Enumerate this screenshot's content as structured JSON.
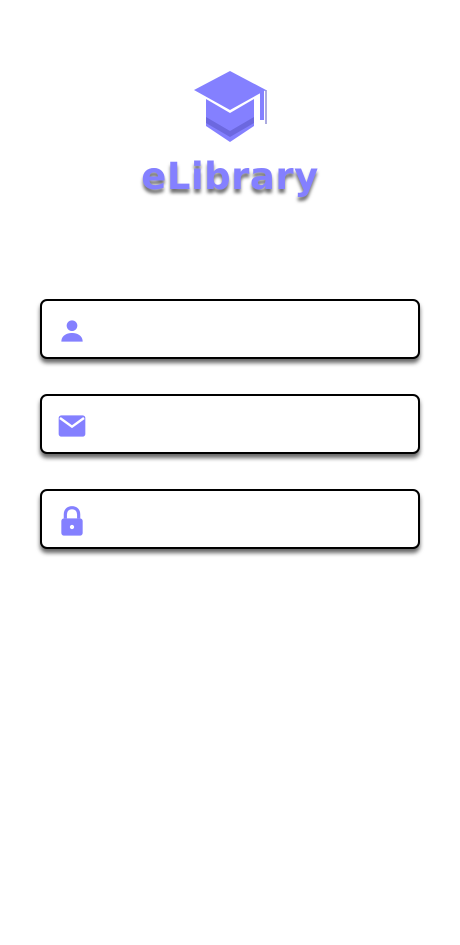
{
  "brand": {
    "name": "eLibrary",
    "accent_color": "#8480ff",
    "logo_icon": "graduation-cap-icon"
  },
  "form": {
    "fields": [
      {
        "icon": "person-icon",
        "value": "",
        "placeholder": ""
      },
      {
        "icon": "mail-icon",
        "value": "",
        "placeholder": ""
      },
      {
        "icon": "lock-icon",
        "value": "",
        "placeholder": ""
      }
    ]
  }
}
